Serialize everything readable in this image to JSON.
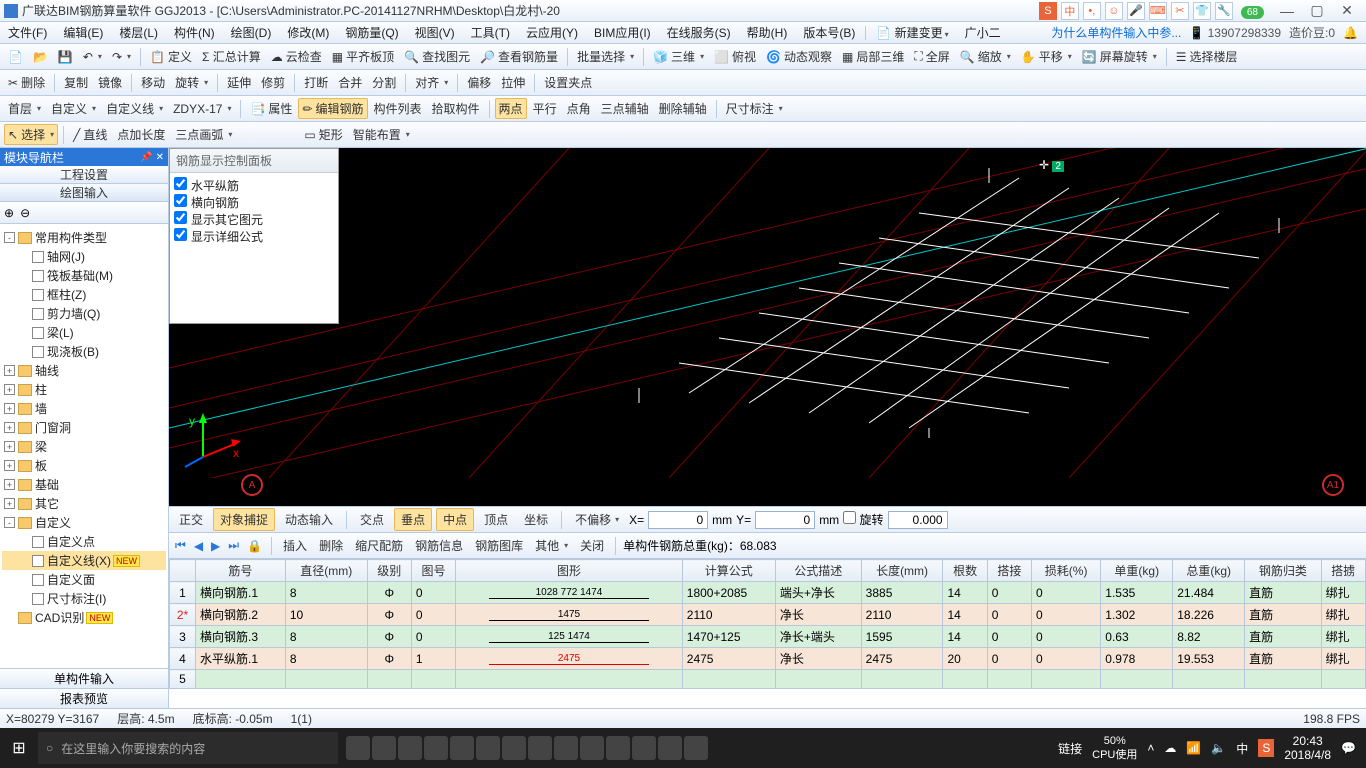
{
  "title": "广联达BIM钢筋算量软件 GGJ2013 - [C:\\Users\\Administrator.PC-20141127NRHM\\Desktop\\白龙村\\-20",
  "ime_badge": "68",
  "menus": [
    "文件(F)",
    "编辑(E)",
    "楼层(L)",
    "构件(N)",
    "绘图(D)",
    "修改(M)",
    "钢筋量(Q)",
    "视图(V)",
    "工具(T)",
    "云应用(Y)",
    "BIM应用(I)",
    "在线服务(S)",
    "帮助(H)",
    "版本号(B)"
  ],
  "menu_right": {
    "new_change": "新建变更",
    "user": "广小二",
    "tip": "为什么单构件输入中参...",
    "phone": "13907298339",
    "coin": "造价豆:0"
  },
  "toolbar1": [
    "定义",
    "Σ 汇总计算",
    "云检查",
    "平齐板顶",
    "查找图元",
    "查看钢筋量",
    "批量选择",
    "三维",
    "俯视",
    "动态观察",
    "局部三维",
    "全屏",
    "缩放",
    "平移",
    "屏幕旋转",
    "选择楼层"
  ],
  "toolbar2": [
    "删除",
    "复制",
    "镜像",
    "移动",
    "旋转",
    "延伸",
    "修剪",
    "打断",
    "合并",
    "分割",
    "对齐",
    "偏移",
    "拉伸",
    "设置夹点"
  ],
  "toolbar3": {
    "floor": "首层",
    "custom": "自定义",
    "line": "自定义线",
    "zdyx": "ZDYX-17",
    "buttons": [
      "属性",
      "编辑钢筋",
      "构件列表",
      "拾取构件",
      "两点",
      "平行",
      "点角",
      "三点辅轴",
      "删除辅轴",
      "尺寸标注"
    ]
  },
  "toolbar4": [
    "选择",
    "直线",
    "点加长度",
    "三点画弧",
    "矩形",
    "智能布置"
  ],
  "leftpanel": {
    "header": "模块导航栏",
    "tabs": [
      "工程设置",
      "绘图输入"
    ],
    "bottom": [
      "单构件输入",
      "报表预览"
    ]
  },
  "tree": [
    {
      "lv": 0,
      "tg": "-",
      "ico": "f",
      "label": "常用构件类型"
    },
    {
      "lv": 1,
      "ico": "o",
      "label": "轴网(J)"
    },
    {
      "lv": 1,
      "ico": "o",
      "label": "筏板基础(M)"
    },
    {
      "lv": 1,
      "ico": "o",
      "label": "框柱(Z)"
    },
    {
      "lv": 1,
      "ico": "o",
      "label": "剪力墙(Q)"
    },
    {
      "lv": 1,
      "ico": "o",
      "label": "梁(L)"
    },
    {
      "lv": 1,
      "ico": "o",
      "label": "现浇板(B)"
    },
    {
      "lv": 0,
      "tg": "+",
      "ico": "f",
      "label": "轴线"
    },
    {
      "lv": 0,
      "tg": "+",
      "ico": "f",
      "label": "柱"
    },
    {
      "lv": 0,
      "tg": "+",
      "ico": "f",
      "label": "墙"
    },
    {
      "lv": 0,
      "tg": "+",
      "ico": "f",
      "label": "门窗洞"
    },
    {
      "lv": 0,
      "tg": "+",
      "ico": "f",
      "label": "梁"
    },
    {
      "lv": 0,
      "tg": "+",
      "ico": "f",
      "label": "板"
    },
    {
      "lv": 0,
      "tg": "+",
      "ico": "f",
      "label": "基础"
    },
    {
      "lv": 0,
      "tg": "+",
      "ico": "f",
      "label": "其它"
    },
    {
      "lv": 0,
      "tg": "-",
      "ico": "f",
      "label": "自定义"
    },
    {
      "lv": 1,
      "ico": "o",
      "label": "自定义点"
    },
    {
      "lv": 1,
      "ico": "o",
      "label": "自定义线(X)",
      "sel": true,
      "new": true
    },
    {
      "lv": 1,
      "ico": "o",
      "label": "自定义面"
    },
    {
      "lv": 1,
      "ico": "o",
      "label": "尺寸标注(I)"
    },
    {
      "lv": 0,
      "ico": "f",
      "label": "CAD识别",
      "new": true
    }
  ],
  "dispanel": {
    "title": "钢筋显示控制面板",
    "items": [
      "水平纵筋",
      "横向钢筋",
      "显示其它图元",
      "显示详细公式"
    ]
  },
  "canvas": {
    "bubbleA": "A",
    "bubbleA1": "A1"
  },
  "snapbar": {
    "items": [
      "正交",
      "对象捕捉",
      "动态输入",
      "交点",
      "垂点",
      "中点",
      "顶点",
      "坐标"
    ],
    "nooffset": "不偏移",
    "x": "0",
    "y": "0",
    "rot": "旋转",
    "rotval": "0.000"
  },
  "gridbar": {
    "buttons": [
      "插入",
      "删除",
      "缩尺配筋",
      "钢筋信息",
      "钢筋图库",
      "其他",
      "关闭"
    ],
    "total_label": "单构件钢筋总重(kg)：",
    "total": "68.083"
  },
  "table": {
    "headers": [
      "",
      "筋号",
      "直径(mm)",
      "级别",
      "图号",
      "图形",
      "计算公式",
      "公式描述",
      "长度(mm)",
      "根数",
      "搭接",
      "损耗(%)",
      "单重(kg)",
      "总重(kg)",
      "钢筋归类",
      "搭掳"
    ],
    "rows": [
      {
        "n": "1",
        "name": "横向钢筋.1",
        "dia": "8",
        "grade": "Φ",
        "fig": "0",
        "shape": "1028  772    1474",
        "formula": "1800+2085",
        "desc": "端头+净长",
        "len": "3885",
        "cnt": "14",
        "lap": "0",
        "loss": "0",
        "uw": "1.535",
        "tw": "21.484",
        "cls": "直筋",
        "end": "绑扎"
      },
      {
        "n": "2*",
        "name": "横向钢筋.2",
        "dia": "10",
        "grade": "Φ",
        "fig": "0",
        "shape": "1475",
        "formula": "2110",
        "desc": "净长",
        "len": "2110",
        "cnt": "14",
        "lap": "0",
        "loss": "0",
        "uw": "1.302",
        "tw": "18.226",
        "cls": "直筋",
        "end": "绑扎",
        "star": true
      },
      {
        "n": "3",
        "name": "横向钢筋.3",
        "dia": "8",
        "grade": "Φ",
        "fig": "0",
        "shape": "125          1474",
        "formula": "1470+125",
        "desc": "净长+端头",
        "len": "1595",
        "cnt": "14",
        "lap": "0",
        "loss": "0",
        "uw": "0.63",
        "tw": "8.82",
        "cls": "直筋",
        "end": "绑扎"
      },
      {
        "n": "4",
        "name": "水平纵筋.1",
        "dia": "8",
        "grade": "Φ",
        "fig": "1",
        "shape": "2475",
        "formula": "2475",
        "desc": "净长",
        "len": "2475",
        "cnt": "20",
        "lap": "0",
        "loss": "0",
        "uw": "0.978",
        "tw": "19.553",
        "cls": "直筋",
        "end": "绑扎"
      }
    ]
  },
  "status": {
    "coords": "X=80279 Y=3167",
    "floor": "层高: 4.5m",
    "bot": "底标高: -0.05m",
    "sel": "1(1)",
    "fps": "198.8 FPS"
  },
  "taskbar": {
    "search": "在这里输入你要搜索的内容",
    "net": "链接",
    "cpu": "50%\nCPU使用",
    "time": "20:43",
    "date": "2018/4/8"
  }
}
